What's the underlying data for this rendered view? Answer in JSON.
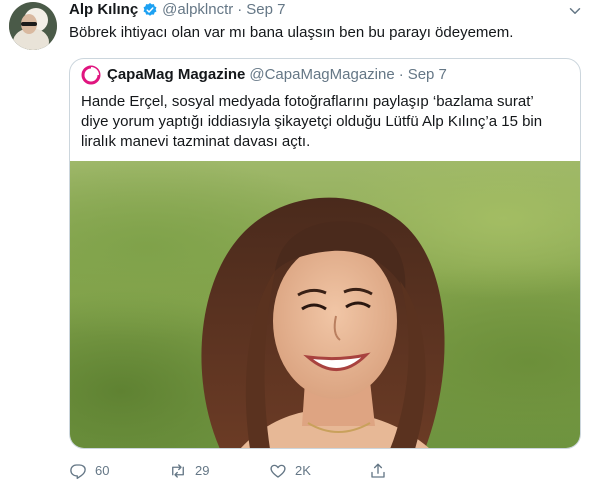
{
  "tweet": {
    "author_name": "Alp Kılınç",
    "author_handle": "@alpklnctr",
    "time": "Sep 7",
    "text": "Böbrek ihtiyacı olan var mı bana ulaşsın ben bu parayı ödeyemem."
  },
  "quoted": {
    "author_name": "ÇapaMag Magazine",
    "author_handle": "@CapaMagMagazine",
    "time": "Sep 7",
    "text_lines": [
      "Hande Erçel, sosyal medyada fotoğraflarını paylaşıp ‘bazlama surat’",
      "diye yorum yaptığı iddiasıyla şikayetçi olduğu Lütfü Alp Kılınç’a 15 bin",
      "liralık manevi tazminat davası açtı."
    ]
  },
  "actions": {
    "reply_count": "60",
    "retweet_count": "29",
    "like_count": "2K"
  },
  "colors": {
    "accent": "#1da1f2",
    "secondary_text": "#657786",
    "border": "#ccd6dd",
    "quoted_logo": "#e0157f"
  },
  "icons": [
    "verified-badge-icon",
    "caret-down-icon",
    "reply-icon",
    "retweet-icon",
    "like-icon",
    "share-icon"
  ]
}
